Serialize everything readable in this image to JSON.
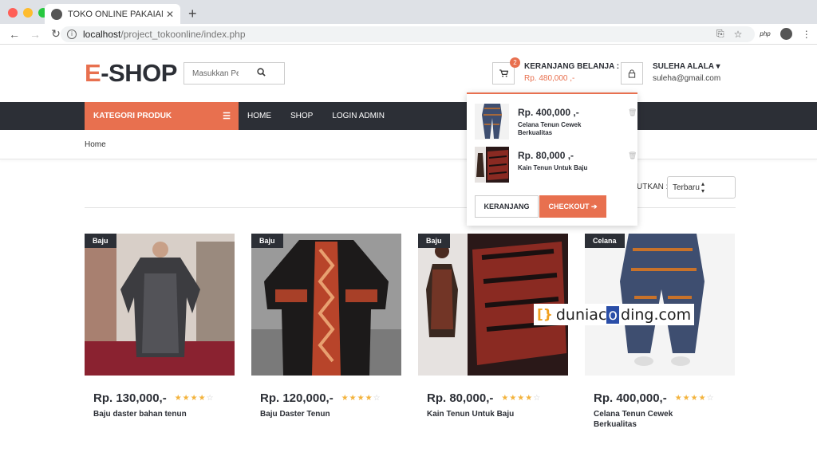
{
  "browser": {
    "tab_title": "TOKO ONLINE PAKAIAN TENUN",
    "url_host": "localhost",
    "url_path": "/project_tokoonline/index.php",
    "ext_label": "php",
    "colors": {
      "close": "#ff5f57",
      "minimize": "#febc2e",
      "maximize": "#28c840"
    }
  },
  "header": {
    "logo_e": "E",
    "logo_rest": "-SHOP",
    "search_placeholder": "Masukkan Pencarian ..",
    "cart_count": "2",
    "cart_title": "KERANJANG BELANJA :",
    "cart_total": "Rp. 480,000 ,-",
    "user_name": "SULEHA ALALA",
    "user_email": "suleha@gmail.com"
  },
  "nav": {
    "category_label": "KATEGORI PRODUK",
    "items": [
      "HOME",
      "SHOP",
      "LOGIN ADMIN"
    ]
  },
  "breadcrumb": {
    "home": "Home"
  },
  "sort": {
    "label": "UTKAN :",
    "selected": "Terbaru"
  },
  "cart_dropdown": {
    "items": [
      {
        "price": "Rp. 400,000 ,-",
        "name": "Celana Tenun Cewek Berkualitas"
      },
      {
        "price": "Rp. 80,000 ,-",
        "name": "Kain Tenun Untuk Baju"
      }
    ],
    "keranjang_label": "KERANJANG",
    "checkout_label": "CHECKOUT"
  },
  "products": [
    {
      "tag": "Baju",
      "price": "Rp. 130,000,-",
      "name": "Baju daster bahan tenun",
      "rating": 4
    },
    {
      "tag": "Baju",
      "price": "Rp. 120,000,-",
      "name": "Baju Daster Tenun",
      "rating": 4
    },
    {
      "tag": "Baju",
      "price": "Rp. 80,000,-",
      "name": "Kain Tenun Untuk Baju",
      "rating": 4
    },
    {
      "tag": "Celana",
      "price": "Rp. 400,000,-",
      "name": "Celana Tenun Cewek Berkualitas",
      "rating": 4
    }
  ],
  "watermark": {
    "bracket": "[}",
    "text_pre": "duniac",
    "text_hl": "o",
    "text_post": "ding.com"
  },
  "theme": {
    "accent": "#e8704f",
    "dark": "#2c2f36",
    "star": "#f3b33d"
  }
}
